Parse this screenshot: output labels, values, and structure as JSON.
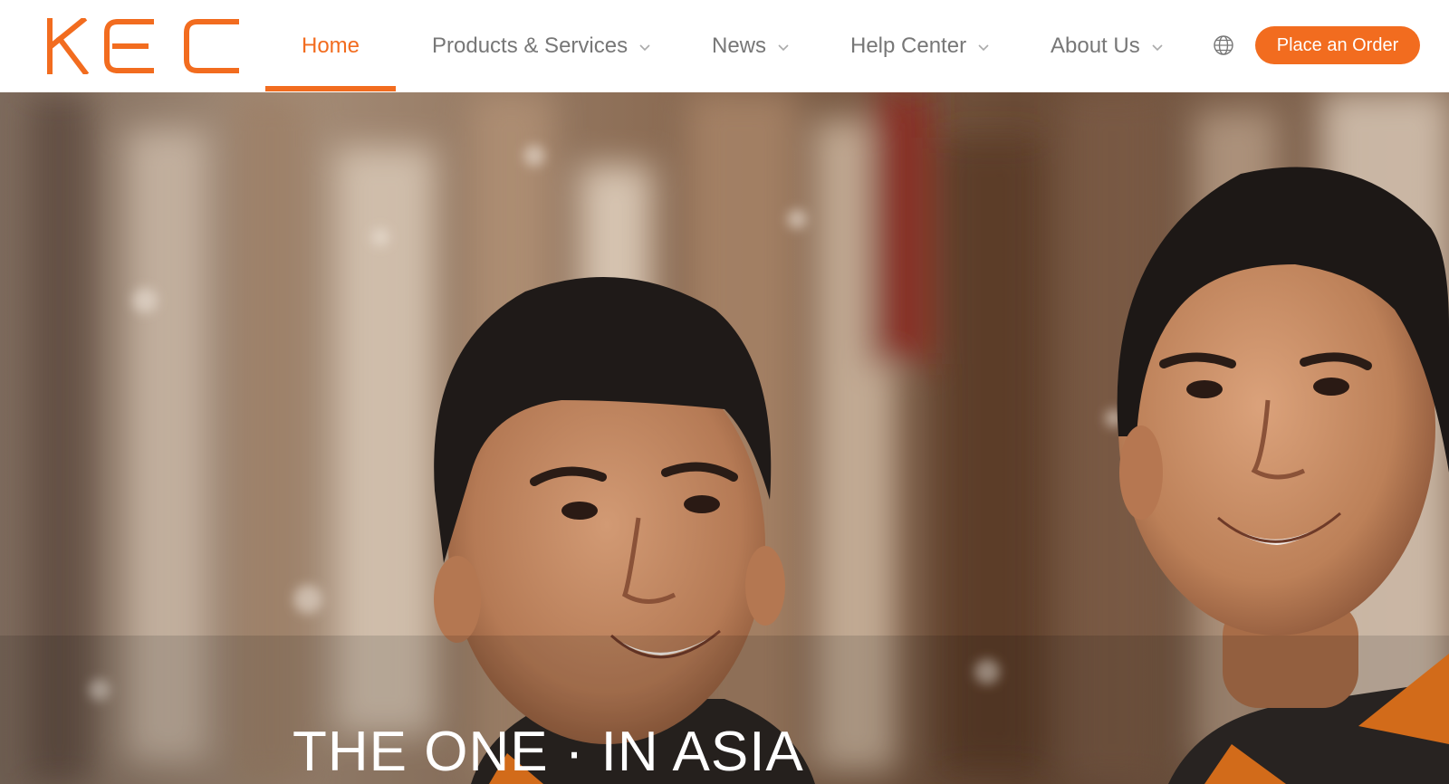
{
  "brand": {
    "logo_text": "KEC",
    "accent_color": "#f26c1f"
  },
  "nav": {
    "items": [
      {
        "label": "Home",
        "active": true,
        "has_dropdown": false
      },
      {
        "label": "Products & Services",
        "active": false,
        "has_dropdown": true
      },
      {
        "label": "News",
        "active": false,
        "has_dropdown": true
      },
      {
        "label": "Help Center",
        "active": false,
        "has_dropdown": true
      },
      {
        "label": "About Us",
        "active": false,
        "has_dropdown": true
      }
    ],
    "language_icon": "globe-icon",
    "dropdown_icon": "chevron-down-icon"
  },
  "cta": {
    "label": "Place an Order"
  },
  "hero": {
    "title": "THE ONE · IN ASIA",
    "image_description_icon": "hero-photo"
  }
}
